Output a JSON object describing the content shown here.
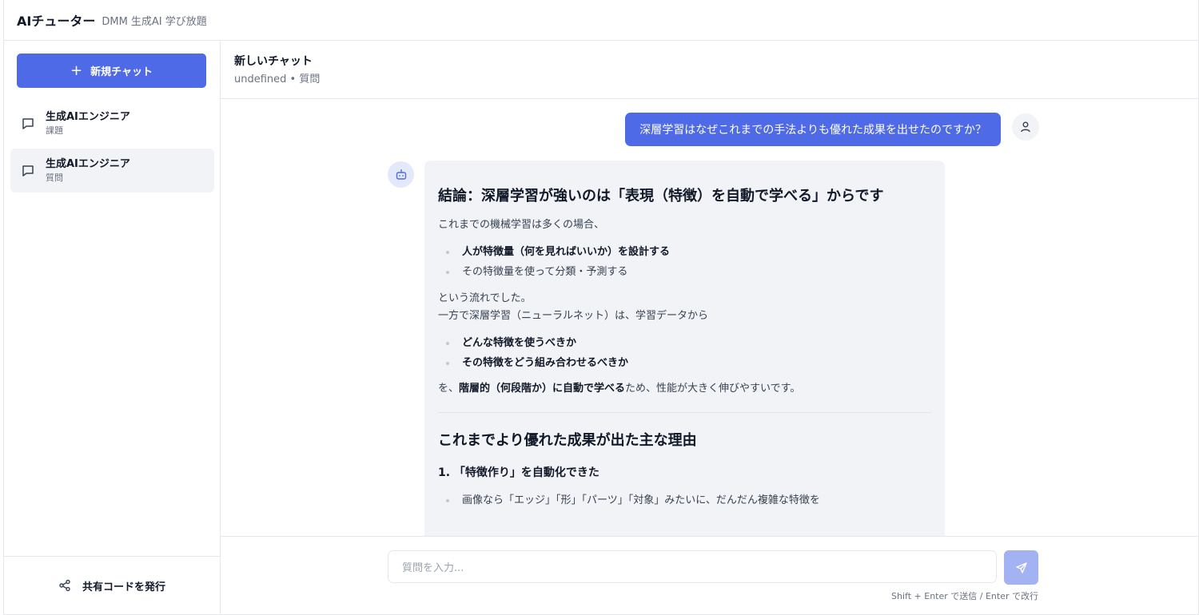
{
  "topbar": {
    "title": "AIチューター",
    "subtitle": "DMM 生成AI 学び放題"
  },
  "sidebar": {
    "new_chat_label": "新規チャット",
    "items": [
      {
        "title": "生成AIエンジニア",
        "subtitle": "課題",
        "active": false
      },
      {
        "title": "生成AIエンジニア",
        "subtitle": "質問",
        "active": true
      }
    ],
    "footer_label": "共有コードを発行"
  },
  "header": {
    "title": "新しいチャット",
    "meta": "undefined • 質問"
  },
  "messages": {
    "user_text": "深層学習はなぜこれまでの手法よりも優れた成果を出せたのですか？",
    "bot": {
      "h1": "結論：深層学習が強いのは「表現（特徴）を自動で学べる」からです",
      "p1": "これまでの機械学習は多くの場合、",
      "list1": [
        "人が特徴量（何を見ればいいか）を設計する",
        "その特徴量を使って分類・予測する"
      ],
      "p2a": "という流れでした。",
      "p2b": "一方で深層学習（ニューラルネット）は、学習データから",
      "list2": [
        "どんな特徴を使うべきか",
        "その特徴をどう組み合わせるべきか"
      ],
      "p3_pre": "を、",
      "p3_bold": "階層的（何段階か）に自動で学べる",
      "p3_post": "ため、性能が大きく伸びやすいです。",
      "h2": "これまでより優れた成果が出た主な理由",
      "h3": "1. 「特徴作り」を自動化できた",
      "list3": [
        "画像なら「エッジ」「形」「パーツ」「対象」みたいに、だんだん複雑な特徴を"
      ]
    }
  },
  "composer": {
    "placeholder": "質問を入力...",
    "hint": "Shift + Enter で送信 / Enter で改行"
  },
  "colors": {
    "accent": "#4f6ae6",
    "send_disabled": "#a3b2f2"
  }
}
